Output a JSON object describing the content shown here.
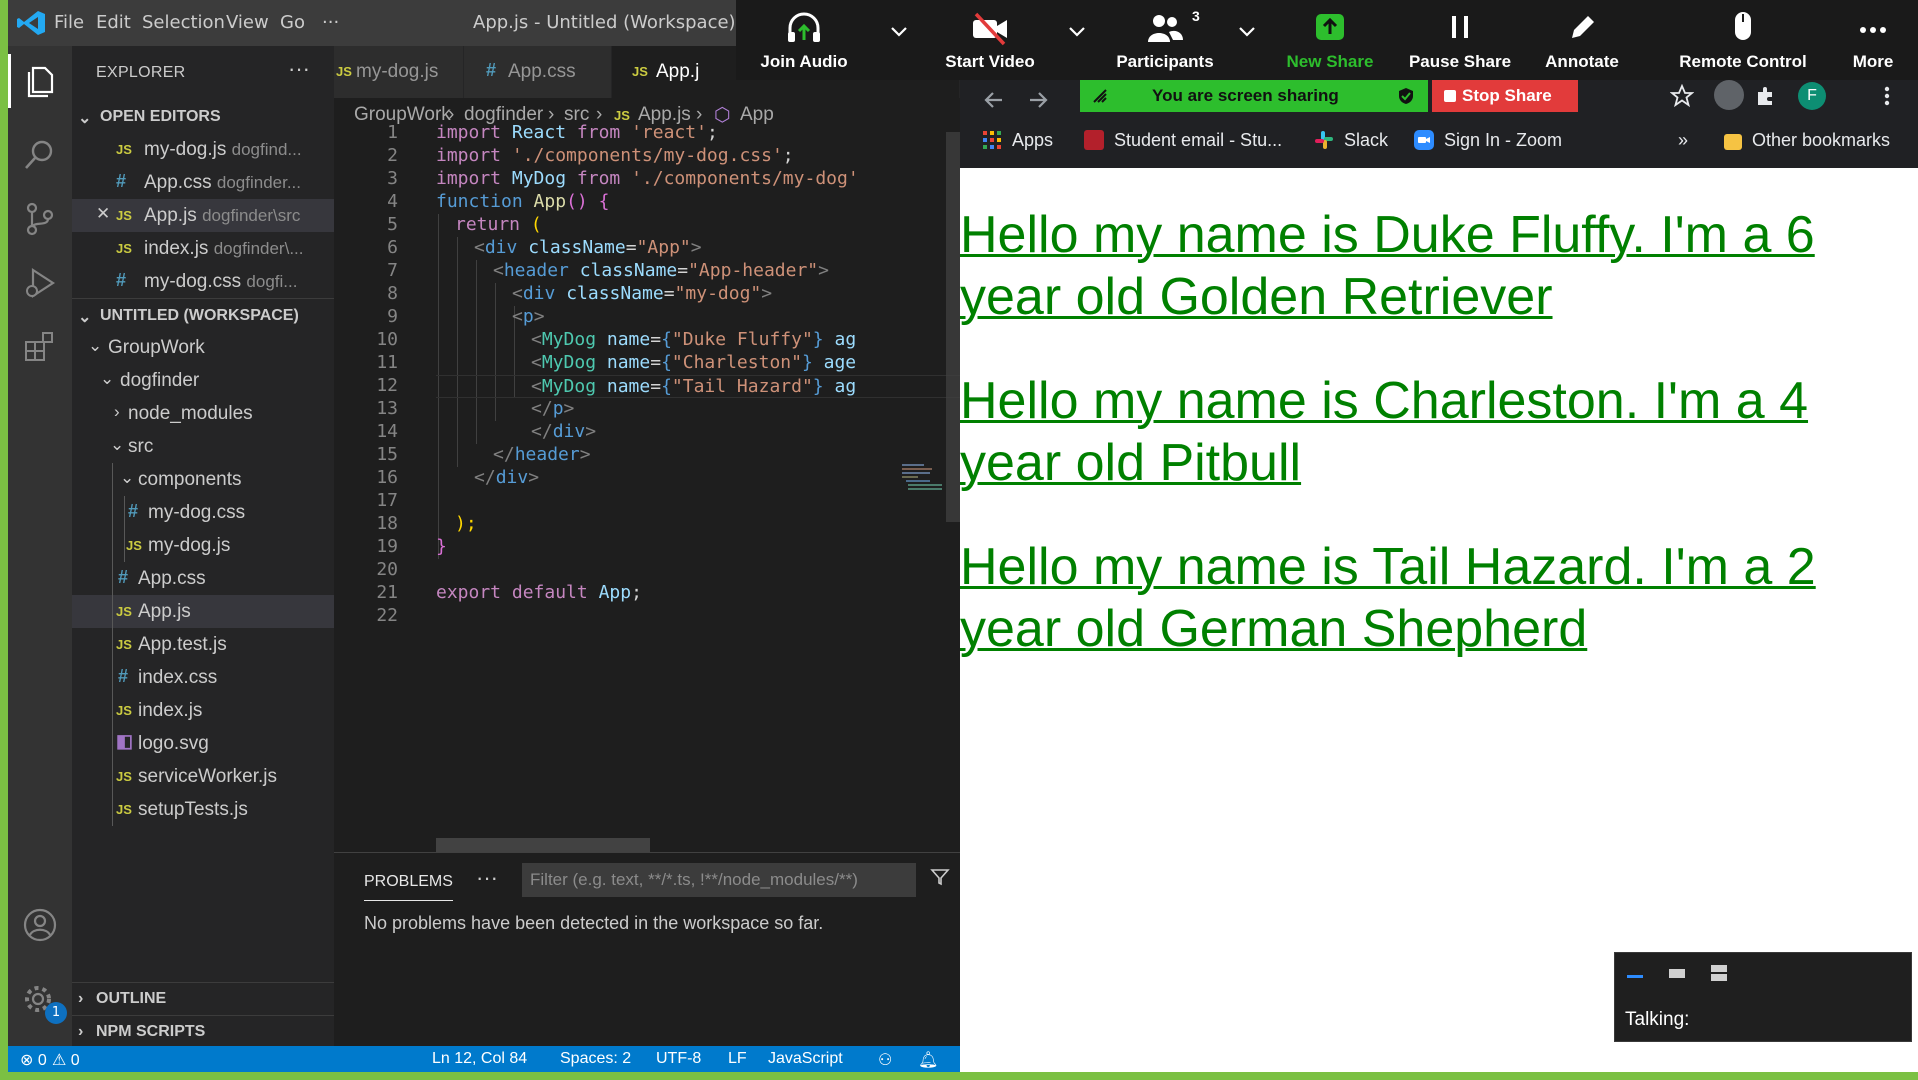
{
  "vscode": {
    "menu": [
      "File",
      "Edit",
      "Selection",
      "View",
      "Go",
      "···"
    ],
    "window_title": "App.js - Untitled (Workspace) - V",
    "explorer": {
      "title": "EXPLORER",
      "more": "···",
      "open_editors_title": "OPEN EDITORS",
      "open_editors": [
        {
          "icon": "JS",
          "name": "my-dog.js",
          "path": "dogfind..."
        },
        {
          "icon": "#",
          "name": "App.css",
          "path": "dogfinder..."
        },
        {
          "icon": "JS",
          "name": "App.js",
          "path": "dogfinder\\src",
          "close": "✕"
        },
        {
          "icon": "JS",
          "name": "index.js",
          "path": "dogfinder\\..."
        },
        {
          "icon": "#",
          "name": "my-dog.css",
          "path": "dogfi..."
        }
      ],
      "workspace_title": "UNTITLED (WORKSPACE)",
      "tree": {
        "groupwork": "GroupWork",
        "dogfinder": "dogfinder",
        "node_modules": "node_modules",
        "src": "src",
        "components": "components",
        "my_dog_css": "my-dog.css",
        "my_dog_js": "my-dog.js",
        "app_css": "App.css",
        "app_js": "App.js",
        "app_test_js": "App.test.js",
        "index_css": "index.css",
        "index_js": "index.js",
        "logo_svg": "logo.svg",
        "service_worker_js": "serviceWorker.js",
        "setup_tests_js": "setupTests.js"
      },
      "icons": {
        "js": "JS",
        "css": "#"
      },
      "outline": "OUTLINE",
      "npm_scripts": "NPM SCRIPTS"
    },
    "tabs": [
      {
        "icon": "JS",
        "label": "my-dog.js"
      },
      {
        "icon": "#",
        "label": "App.css"
      },
      {
        "icon": "JS",
        "label": "App.j"
      }
    ],
    "breadcrumb": [
      "GroupWork",
      "dogfinder",
      "src",
      "JS",
      "App.js",
      "App"
    ],
    "line_numbers": [
      "1",
      "2",
      "3",
      "4",
      "5",
      "6",
      "7",
      "8",
      "9",
      "10",
      "11",
      "12",
      "13",
      "14",
      "15",
      "16",
      "17",
      "18",
      "19",
      "20",
      "21",
      "22"
    ],
    "code": {
      "l1": [
        "import",
        " React ",
        "from",
        " 'react'",
        ";"
      ],
      "l2": [
        "import",
        " './components/my-dog.css'",
        ";"
      ],
      "l3": [
        "import",
        " MyDog ",
        "from",
        " './components/my-dog'"
      ],
      "l4": [
        "function",
        " App",
        "()",
        " {"
      ],
      "l5": [
        "return",
        " ("
      ],
      "l6": [
        "<",
        "div",
        " className",
        "=",
        "\"App\"",
        ">"
      ],
      "l7": [
        "<",
        "header",
        " className",
        "=",
        "\"App-header\"",
        ">"
      ],
      "l8": [
        "<",
        "div",
        " className",
        "=",
        "\"my-dog\"",
        ">"
      ],
      "l9": [
        "<",
        "p",
        ">"
      ],
      "l10": [
        "<",
        "MyDog",
        " name",
        "=",
        "{",
        "\"Duke Fluffy\"",
        "}",
        " ag"
      ],
      "l11": [
        "<",
        "MyDog",
        " name",
        "=",
        "{",
        "\"Charleston\"",
        "}",
        " age"
      ],
      "l12": [
        "<",
        "MyDog",
        " name",
        "=",
        "{",
        "\"Tail Hazard\"",
        "}",
        " ag"
      ],
      "l13": [
        "</",
        "p",
        ">"
      ],
      "l14": [
        "</",
        "div",
        ">"
      ],
      "l15": [
        "</",
        "header",
        ">"
      ],
      "l16": [
        "</",
        "div",
        ">"
      ],
      "l18": [
        ");"
      ],
      "l19": [
        "}"
      ],
      "l21": [
        "export",
        " default",
        " App",
        ";"
      ]
    },
    "panel": {
      "tab": "PROBLEMS",
      "more": "···",
      "filter_placeholder": "Filter (e.g. text, **/*.ts, !**/node_modules/**)",
      "message": "No problems have been detected in the workspace so far."
    },
    "status": {
      "errors": "⊗ 0",
      "warnings": "⚠ 0",
      "position": "Ln 12, Col 84",
      "spaces": "Spaces: 2",
      "encoding": "UTF-8",
      "eol": "LF",
      "language": "JavaScript"
    },
    "settings_badge": "1"
  },
  "zoom": {
    "join_audio": "Join Audio",
    "start_video": "Start Video",
    "participants": "Participants",
    "participants_count": "3",
    "new_share": "New Share",
    "pause_share": "Pause Share",
    "annotate": "Annotate",
    "remote_control": "Remote Control",
    "more": "More",
    "sharing_banner": "You are screen sharing",
    "stop_share": "Stop Share",
    "talking": "Talking:",
    "colors": {
      "toolbar": "#1a1a1a",
      "new_share": "#2dbe2d",
      "stop_share": "#e23b3b"
    }
  },
  "chrome": {
    "profile_initial": "F",
    "bookmarks": [
      {
        "label": "Apps",
        "color": "#ea4335"
      },
      {
        "label": "Student email - Stu...",
        "color": "#b3202b"
      },
      {
        "label": "Slack",
        "color": "#e01e5a"
      },
      {
        "label": "Sign In - Zoom",
        "color": "#2d8cff"
      }
    ],
    "more_bookmarks": "»",
    "other_bookmarks": "Other bookmarks"
  },
  "webpage": {
    "dogs": [
      "Hello my name is Duke Fluffy. I'm a 6 year old Golden Retriever",
      "Hello my name is Charleston. I'm a 4 year old Pitbull",
      "Hello my name is Tail Hazard. I'm a 2 year old German Shepherd"
    ],
    "link_color": "#008000"
  }
}
